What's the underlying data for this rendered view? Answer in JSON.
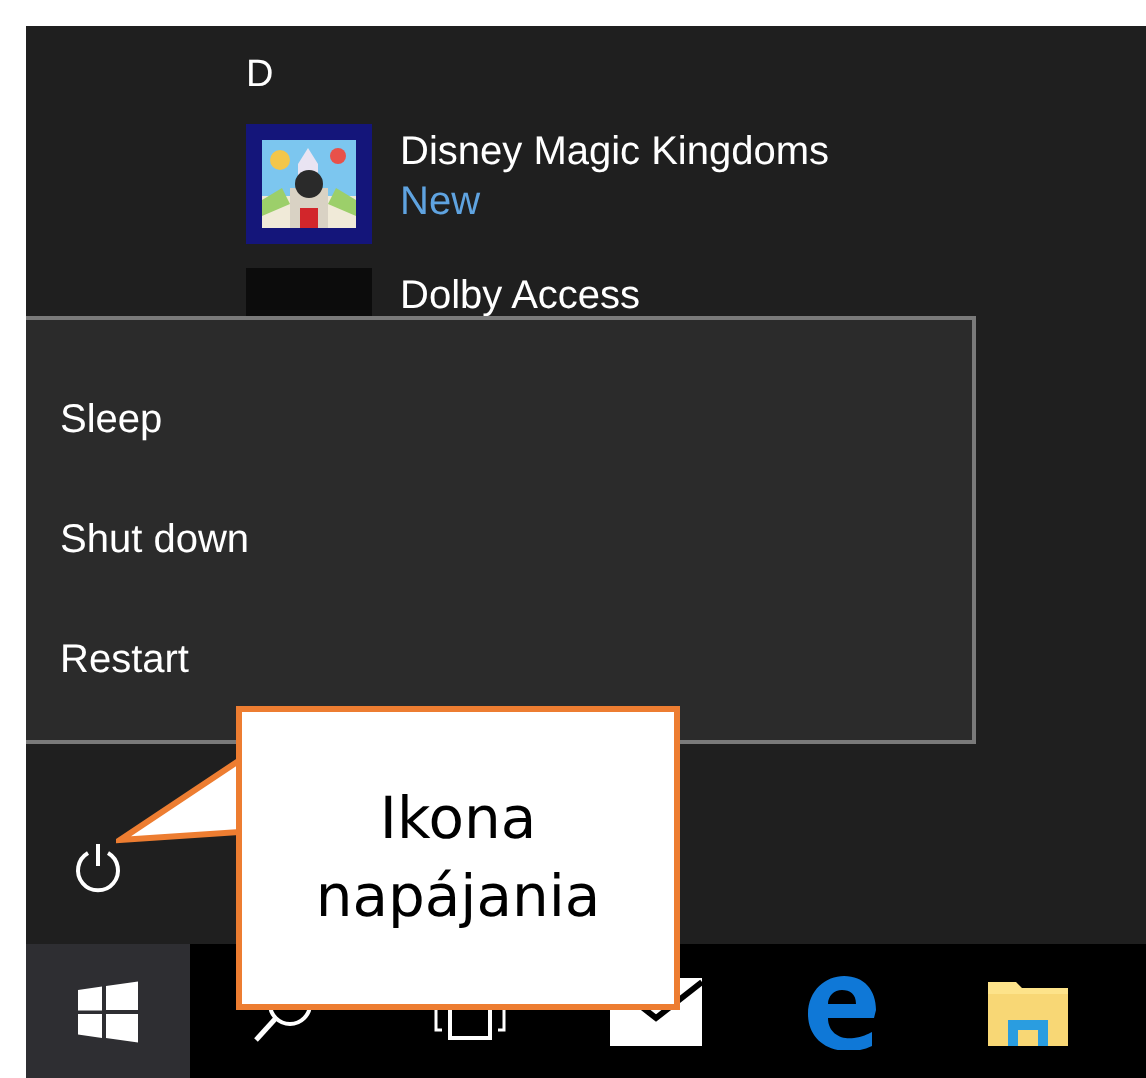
{
  "start_menu": {
    "section_letter": "D",
    "apps": [
      {
        "name": "Disney Magic Kingdoms",
        "badge": "New",
        "kind": "picture"
      },
      {
        "name": "Dolby Access",
        "kind": "plain"
      }
    ]
  },
  "power_menu": {
    "items": [
      "Sleep",
      "Shut down",
      "Restart"
    ]
  },
  "callout": {
    "text": "Ikona napájania"
  }
}
